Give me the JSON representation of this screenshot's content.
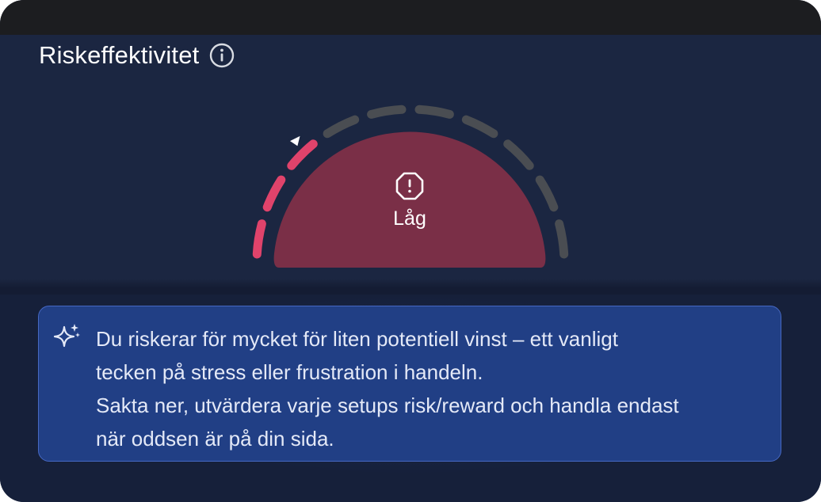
{
  "card": {
    "title": "Riskeffektivitet",
    "info_icon": "info-circle-icon"
  },
  "gauge": {
    "label": "Låg",
    "status_icon": "warning-octagon-icon",
    "segments_total": 10,
    "segments_active": 3,
    "level": 0.28,
    "colors": {
      "active": "#e0436b",
      "inactive": "#4a4d52",
      "fill": "#7a2f47",
      "marker": "#ffffff"
    }
  },
  "advice": {
    "icon": "sparkles-icon",
    "line1": "Du riskerar för mycket för liten potentiell vinst – ett vanligt",
    "line2": "tecken på stress eller frustration i handeln.",
    "line3": "Sakta ner, utvärdera varje setups risk/reward och handla endast",
    "line4": "när oddsen är på din sida."
  }
}
